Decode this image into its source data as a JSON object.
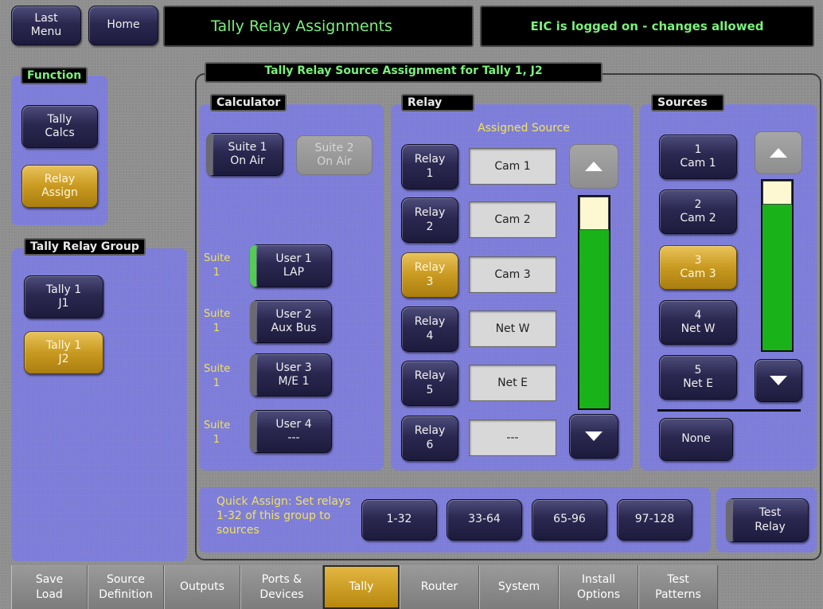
{
  "header": {
    "last_menu": "Last\nMenu",
    "home": "Home",
    "title": "Tally Relay Assignments",
    "status": "EIC is logged on - changes allowed"
  },
  "function": {
    "title": "Function",
    "items": [
      "Tally\nCalcs",
      "Relay\nAssign"
    ],
    "active_index": 1
  },
  "group": {
    "title": "Tally Relay Group",
    "items": [
      "Tally 1\nJ1",
      "Tally 1\nJ2"
    ],
    "active_index": 1
  },
  "main": {
    "title": "Tally Relay Source Assignment for Tally 1, J2"
  },
  "calculator": {
    "title": "Calculator",
    "suite1": "Suite 1\nOn Air",
    "suite2": "Suite 2\nOn Air",
    "users": [
      {
        "suite": "Suite\n1",
        "label": "User 1\nLAP"
      },
      {
        "suite": "Suite\n1",
        "label": "User 2\nAux Bus"
      },
      {
        "suite": "Suite\n1",
        "label": "User 3\nM/E 1"
      },
      {
        "suite": "Suite\n1",
        "label": "User 4\n---"
      }
    ]
  },
  "relay": {
    "title": "Relay",
    "assigned_header": "Assigned Source",
    "rows": [
      {
        "label": "Relay\n1",
        "source": "Cam 1"
      },
      {
        "label": "Relay\n2",
        "source": "Cam 2"
      },
      {
        "label": "Relay\n3",
        "source": "Cam 3"
      },
      {
        "label": "Relay\n4",
        "source": "Net W"
      },
      {
        "label": "Relay\n5",
        "source": "Net E"
      },
      {
        "label": "Relay\n6",
        "source": "---"
      }
    ],
    "active_index": 2
  },
  "sources": {
    "title": "Sources",
    "items": [
      "1\nCam 1",
      "2\nCam 2",
      "3\nCam 3",
      "4\nNet W",
      "5\nNet E"
    ],
    "active_index": 2,
    "none": "None"
  },
  "quick_assign": {
    "text": "Quick Assign:  Set relays 1-32 of this group to sources",
    "buttons": [
      "1-32",
      "33-64",
      "65-96",
      "97-128"
    ]
  },
  "test_relay": "Test\nRelay",
  "tabs": [
    "Save\nLoad",
    "Source\nDefinition",
    "Outputs",
    "Ports &\nDevices",
    "Tally",
    "Router",
    "System",
    "Install\nOptions",
    "Test\nPatterns"
  ],
  "active_tab": "Tally",
  "colors": {
    "panel": "#7b7bd8",
    "gold": "#c99a20",
    "status_green": "#7cf07c",
    "suite_yellow": "#f0e25a"
  }
}
